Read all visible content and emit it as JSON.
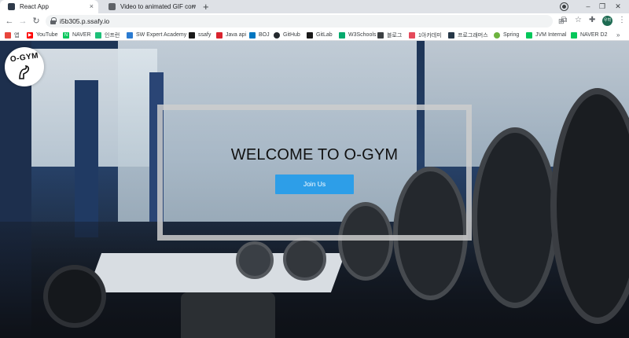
{
  "browser": {
    "tabs": [
      {
        "title": "React App",
        "favicon_color": "#2f3a4a",
        "active": true
      },
      {
        "title": "Video to animated GIF converter",
        "favicon_color": "#5f6368",
        "active": false
      }
    ],
    "new_tab_glyph": "+",
    "close_glyph": "×",
    "window_controls": {
      "minimize": "–",
      "maximize": "❐",
      "close": "✕"
    },
    "nav": {
      "back": "←",
      "forward": "→",
      "reload": "↻"
    },
    "address_bar": {
      "url": "i5b305.p.ssafy.io"
    },
    "toolbar_icons": [
      "translate-icon",
      "star-icon",
      "puzzle-icon",
      "menu-icon"
    ],
    "profile_avatar_text": "우혁",
    "bookmarks": [
      {
        "label": "앱",
        "icon": "apps-grid-icon",
        "color": "#e8453c"
      },
      {
        "label": "YouTube",
        "icon": "youtube-icon",
        "color": "#ff0000"
      },
      {
        "label": "NAVER",
        "icon": "naver-icon",
        "color": "#03c75a"
      },
      {
        "label": "인프런",
        "icon": "inflearn-icon",
        "color": "#1dc078"
      },
      {
        "label": "SW Expert Academy",
        "icon": "swea-icon",
        "color": "#2b7bd1"
      },
      {
        "label": "ssafy",
        "icon": "ssafy-icon",
        "color": "#1a1a1a"
      },
      {
        "label": "Java api",
        "icon": "java-icon",
        "color": "#d9232e"
      },
      {
        "label": "BOJ",
        "icon": "boj-icon",
        "color": "#0076c0"
      },
      {
        "label": "GitHub",
        "icon": "github-icon",
        "color": "#24292e"
      },
      {
        "label": "GitLab",
        "icon": "gitlab-icon",
        "color": "#1a1a1a"
      },
      {
        "label": "W3Schools",
        "icon": "w3schools-icon",
        "color": "#04aa6d"
      },
      {
        "label": "블로그",
        "icon": "blog-icon",
        "color": "#3c4043"
      },
      {
        "label": "1아카데미",
        "icon": "academy-icon",
        "color": "#e54a5b"
      },
      {
        "label": "프로그래머스",
        "icon": "programmers-icon",
        "color": "#263747"
      },
      {
        "label": "Spring",
        "icon": "spring-icon",
        "color": "#6db33f"
      },
      {
        "label": "JVM Internal",
        "icon": "jvm-icon",
        "color": "#03c75a"
      },
      {
        "label": "NAVER D2",
        "icon": "naver-d2-icon",
        "color": "#03c75a"
      }
    ],
    "bookmarks_overflow": "»"
  },
  "page": {
    "logo_text": "O-GYM",
    "hero_title": "WELCOME TO O-GYM",
    "join_button_label": "Join Us",
    "colors": {
      "button": "#2d9ee8",
      "frame": "#cdcdcd"
    }
  }
}
